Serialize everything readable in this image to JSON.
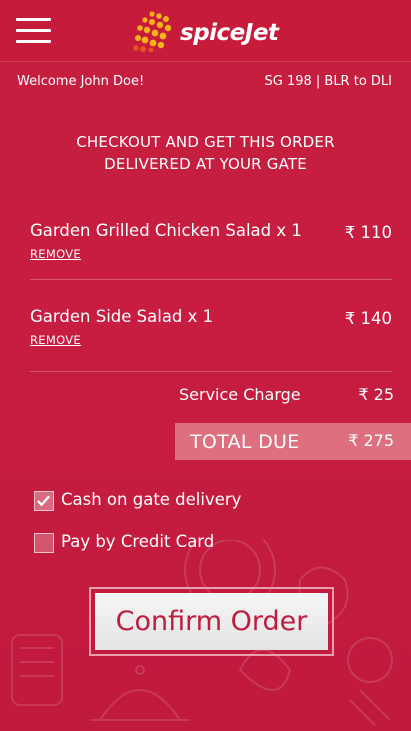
{
  "header": {
    "menu_icon": "hamburger-menu-icon",
    "logo_text": "spiceJet",
    "logo_icon": "spicejet-logo-icon"
  },
  "info": {
    "welcome": "Welcome John Doe!",
    "flight": "SG 198 | BLR to DLI"
  },
  "checkout": {
    "heading_line1": "CHECKOUT AND GET THIS ORDER",
    "heading_line2": "DELIVERED AT YOUR GATE"
  },
  "items": [
    {
      "name": "Garden Grilled Chicken Salad x 1",
      "price": "₹ 110",
      "remove_label": "REMOVE"
    },
    {
      "name": "Garden Side Salad x 1",
      "price": "₹ 140",
      "remove_label": "REMOVE"
    }
  ],
  "summary": {
    "service_label": "Service Charge",
    "service_value": "₹ 25",
    "total_label": "TOTAL DUE",
    "total_value": "₹ 275"
  },
  "payment": {
    "options": [
      {
        "label": "Cash on gate delivery",
        "checked": true
      },
      {
        "label": "Pay by Credit Card",
        "checked": false
      }
    ]
  },
  "actions": {
    "confirm_label": "Confirm Order"
  },
  "colors": {
    "primary": "#c71b3c",
    "total_bg": "#dd6f7f",
    "button_text": "#c01c3e",
    "logo_accent": "#f6b21b"
  }
}
